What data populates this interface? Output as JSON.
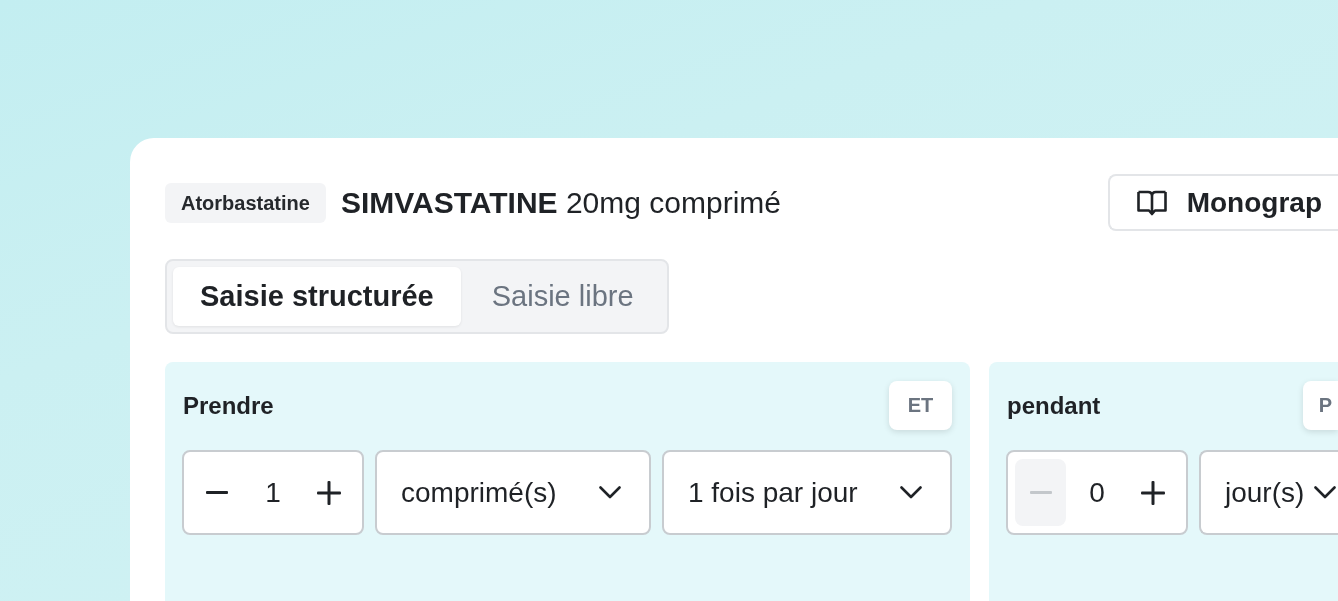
{
  "drug": {
    "tag": "Atorbastatine",
    "title": "**SIMVASTATINE** 20mg comprimé"
  },
  "monograph_button": {
    "label": "Monograp"
  },
  "tabs": [
    {
      "label": "Saisie structurée",
      "selected": true
    },
    {
      "label": "Saisie libre",
      "selected": false
    }
  ],
  "panels": [
    {
      "title": "Prendre",
      "action": "ET",
      "controls": [
        {
          "kind": "stepper",
          "value": "1",
          "decrement_disabled": false
        },
        {
          "kind": "select",
          "value": "comprimé(s)"
        },
        {
          "kind": "select",
          "value": "1 fois par jour"
        }
      ]
    },
    {
      "title": "pendant",
      "action": "P",
      "controls": [
        {
          "kind": "stepper",
          "value": "0",
          "decrement_disabled": true
        },
        {
          "kind": "select",
          "value": "jour(s)"
        }
      ]
    }
  ]
}
